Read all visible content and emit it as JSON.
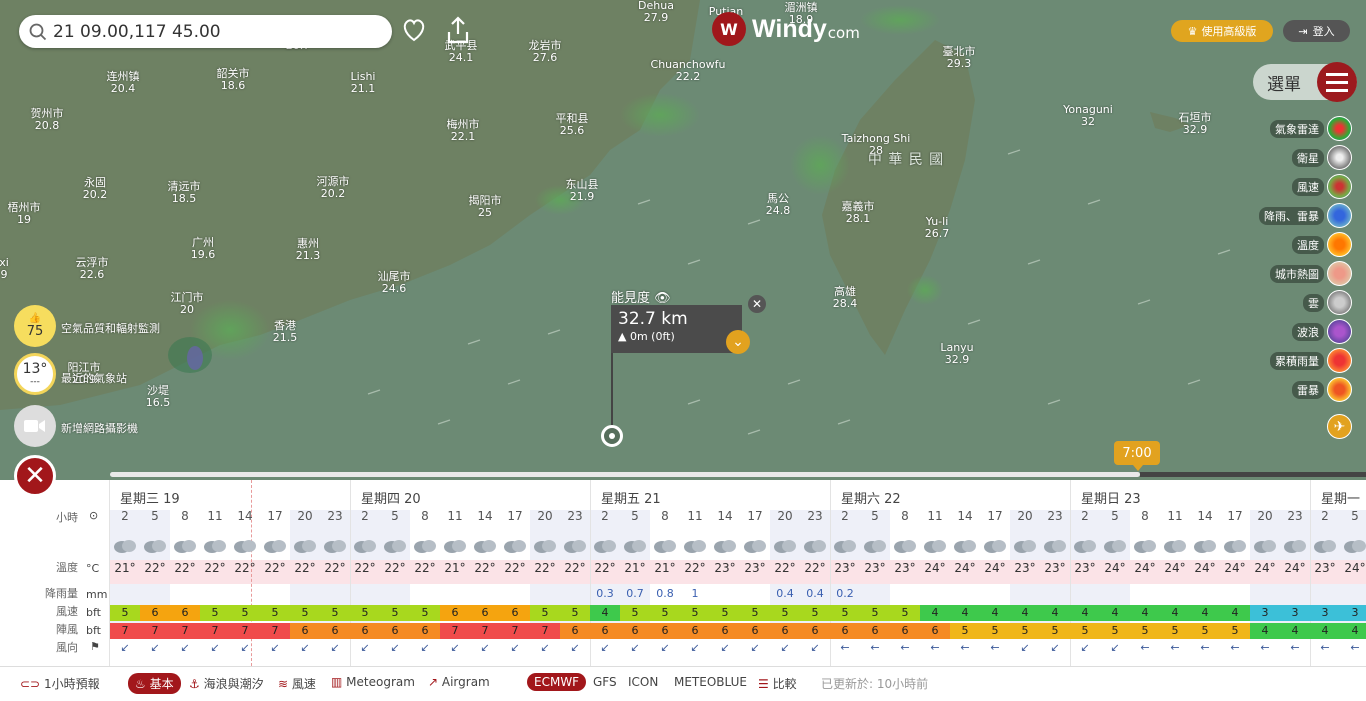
{
  "search": {
    "value": "21 09.00,117 45.00"
  },
  "brand": {
    "name": "Windy",
    "suffix": "com"
  },
  "header": {
    "premium": "使用高級版",
    "login": "登入",
    "menu": "選單"
  },
  "places": [
    {
      "name": "",
      "temp": "20.7"
    },
    {
      "name": "武平县",
      "temp": "24.1"
    },
    {
      "name": "龙岩市",
      "temp": "27.6"
    },
    {
      "name": "Dehua",
      "temp": "27.9"
    },
    {
      "name": "Putian",
      "temp": ""
    },
    {
      "name": "湄洲镇",
      "temp": "18.9"
    },
    {
      "name": "连州镇",
      "temp": "20.4"
    },
    {
      "name": "韶关市",
      "temp": "18.6"
    },
    {
      "name": "Lishi",
      "temp": "21.1"
    },
    {
      "name": "Chuanchowfu",
      "temp": "22.2"
    },
    {
      "name": "臺北市",
      "temp": "29.3"
    },
    {
      "name": "Yonaguni",
      "temp": "32"
    },
    {
      "name": "石垣市",
      "temp": "32.9"
    },
    {
      "name": "贺州市",
      "temp": "20.8"
    },
    {
      "name": "梅州市",
      "temp": "22.1"
    },
    {
      "name": "平和县",
      "temp": "25.6"
    },
    {
      "name": "Taizhong Shi",
      "temp": "28"
    },
    {
      "name": "永固",
      "temp": "20.2"
    },
    {
      "name": "清远市",
      "temp": "18.5"
    },
    {
      "name": "河源市",
      "temp": "20.2"
    },
    {
      "name": "东山县",
      "temp": "21.9"
    },
    {
      "name": "揭阳市",
      "temp": "25"
    },
    {
      "name": "馬公",
      "temp": "24.8"
    },
    {
      "name": "嘉義市",
      "temp": "28.1"
    },
    {
      "name": "梧州市",
      "temp": "19"
    },
    {
      "name": "广州",
      "temp": "19.6"
    },
    {
      "name": "惠州",
      "temp": "21.3"
    },
    {
      "name": "Yu-li",
      "temp": "26.7"
    },
    {
      "name": "云浮市",
      "temp": "22.6"
    },
    {
      "name": "汕尾市",
      "temp": "24.6"
    },
    {
      "name": "江门市",
      "temp": "20"
    },
    {
      "name": "高雄",
      "temp": "28.4"
    },
    {
      "name": "香港",
      "temp": "21.5"
    },
    {
      "name": "Lanyu",
      "temp": "32.9"
    },
    {
      "name": "沙堤",
      "temp": "16.5"
    },
    {
      "name": "阳江市",
      "temp": "20.9"
    },
    {
      "name": "xi",
      "temp": "9"
    }
  ],
  "map_labels": {
    "taiwan": "中 華 民 國"
  },
  "layers": [
    "氣象雷達",
    "衛星",
    "風速",
    "降雨、雷暴",
    "溫度",
    "城市熱圖",
    "雲",
    "波浪",
    "累積雨量",
    "雷暴"
  ],
  "left_widgets": {
    "aqi_value": "75",
    "aqi_label": "空氣品質和輻射監測",
    "station_temp": "13°",
    "station_sub": "---",
    "station_label": "最近的氣象站",
    "webcam_label": "新增網路攝影機"
  },
  "picker": {
    "label": "能見度",
    "value": "32.7 km",
    "sub": "0m (0ft)"
  },
  "timeline": {
    "time": "7:00"
  },
  "forecast": {
    "row_labels": {
      "hour": "小時",
      "temp": "溫度",
      "rain": "降雨量",
      "wind": "風速",
      "gust": "陣風",
      "dir": "風向"
    },
    "units": {
      "temp": "°C",
      "rain": "mm",
      "wind": "bft",
      "gust": "bft"
    },
    "days": [
      "星期三 19",
      "星期四 20",
      "星期五 21",
      "星期六 22",
      "星期日 23",
      "星期一"
    ],
    "hours": [
      "2",
      "5",
      "8",
      "11",
      "14",
      "17",
      "20",
      "23",
      "2",
      "5",
      "8",
      "11",
      "14",
      "17",
      "20",
      "23",
      "2",
      "5",
      "8",
      "11",
      "14",
      "17",
      "20",
      "23",
      "2",
      "5",
      "8",
      "11",
      "14",
      "17",
      "20",
      "23",
      "2",
      "5",
      "8",
      "11",
      "14",
      "17",
      "20",
      "23",
      "2",
      "5"
    ],
    "temps": [
      "21°",
      "22°",
      "22°",
      "22°",
      "22°",
      "22°",
      "22°",
      "22°",
      "22°",
      "22°",
      "22°",
      "21°",
      "22°",
      "22°",
      "22°",
      "22°",
      "22°",
      "21°",
      "21°",
      "22°",
      "23°",
      "23°",
      "22°",
      "22°",
      "23°",
      "23°",
      "23°",
      "24°",
      "24°",
      "24°",
      "23°",
      "23°",
      "23°",
      "24°",
      "24°",
      "24°",
      "24°",
      "24°",
      "24°",
      "24°",
      "23°",
      "24°"
    ],
    "rain": [
      "",
      "",
      "",
      "",
      "",
      "",
      "",
      "",
      "",
      "",
      "",
      "",
      "",
      "",
      "",
      "",
      "0.3",
      "0.7",
      "0.8",
      "1",
      "",
      "",
      "0.4",
      "0.4",
      "0.2",
      "",
      "",
      "",
      "",
      "",
      "",
      "",
      "",
      "",
      "",
      "",
      "",
      "",
      "",
      "",
      "",
      ""
    ],
    "wind": [
      5,
      6,
      6,
      5,
      5,
      5,
      5,
      5,
      5,
      5,
      5,
      6,
      6,
      6,
      5,
      5,
      4,
      5,
      5,
      5,
      5,
      5,
      5,
      5,
      5,
      5,
      5,
      4,
      4,
      4,
      4,
      4,
      4,
      4,
      4,
      4,
      4,
      4,
      3,
      3,
      3,
      3
    ],
    "gust": [
      7,
      7,
      7,
      7,
      7,
      7,
      6,
      6,
      6,
      6,
      6,
      7,
      7,
      7,
      7,
      6,
      6,
      6,
      6,
      6,
      6,
      6,
      6,
      6,
      6,
      6,
      6,
      6,
      5,
      5,
      5,
      5,
      5,
      5,
      5,
      5,
      5,
      5,
      4,
      4,
      4,
      4
    ],
    "dirs": [
      "↙",
      "↙",
      "↙",
      "↙",
      "↙",
      "↙",
      "↙",
      "↙",
      "↙",
      "↙",
      "↙",
      "↙",
      "↙",
      "↙",
      "↙",
      "↙",
      "↙",
      "↙",
      "↙",
      "↙",
      "↙",
      "↙",
      "↙",
      "↙",
      "←",
      "←",
      "←",
      "←",
      "←",
      "←",
      "↙",
      "↙",
      "↙",
      "↙",
      "←",
      "←",
      "←",
      "←",
      "←",
      "←",
      "←",
      "←"
    ]
  },
  "bottom": {
    "hourly": "1小時預報",
    "basic": "基本",
    "waves": "海浪與潮汐",
    "wind": "風速",
    "meteogram": "Meteogram",
    "airgram": "Airgram",
    "ecmwf": "ECMWF",
    "gfs": "GFS",
    "icon": "ICON",
    "meteoblue": "METEOBLUE",
    "compare": "比較",
    "updated": "已更新於: 10小時前"
  }
}
